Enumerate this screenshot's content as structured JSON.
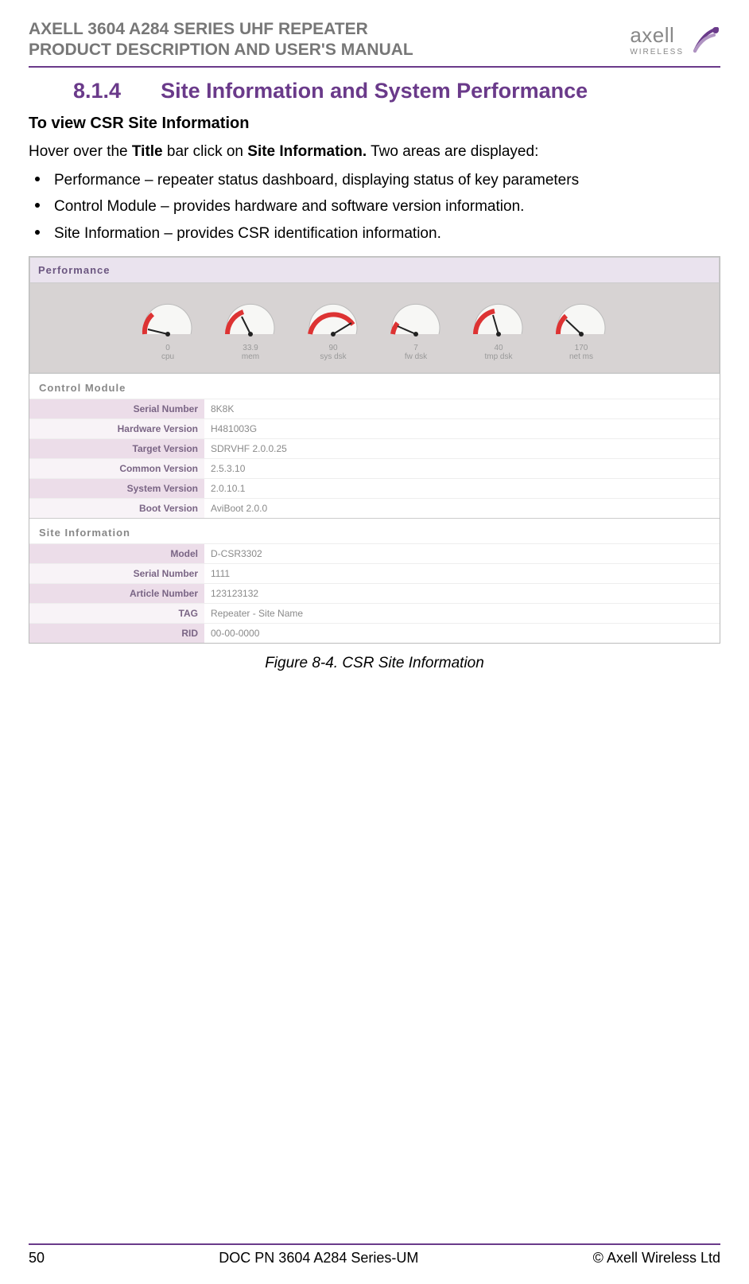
{
  "header": {
    "line1": "AXELL 3604 A284 SERIES UHF REPEATER",
    "line2": "PRODUCT DESCRIPTION AND USER'S MANUAL",
    "brand_name": "axell",
    "brand_sub": "WIRELESS"
  },
  "section": {
    "number": "8.1.4",
    "title": "Site Information and System Performance"
  },
  "subheading": "To view CSR Site Information",
  "intro_pre": "Hover over the ",
  "intro_bold1": "Title",
  "intro_mid": " bar click on ",
  "intro_bold2": "Site Information.",
  "intro_post": " Two areas are displayed:",
  "bullets": [
    "Performance – repeater status dashboard, displaying status of key parameters",
    "Control Module – provides hardware and software version information.",
    "Site Information – provides CSR identification information."
  ],
  "panels": {
    "performance_title": "Performance",
    "gauges": [
      {
        "label": "cpu",
        "value": "0"
      },
      {
        "label": "mem",
        "value": "33.9"
      },
      {
        "label": "sys dsk",
        "value": "90"
      },
      {
        "label": "fw dsk",
        "value": "7"
      },
      {
        "label": "tmp dsk",
        "value": "40"
      },
      {
        "label": "net ms",
        "value": "170"
      }
    ],
    "control_module_title": "Control Module",
    "control_module_rows": [
      {
        "k": "Serial Number",
        "v": "8K8K"
      },
      {
        "k": "Hardware Version",
        "v": "H481003G"
      },
      {
        "k": "Target Version",
        "v": "SDRVHF 2.0.0.25"
      },
      {
        "k": "Common Version",
        "v": "2.5.3.10"
      },
      {
        "k": "System Version",
        "v": "2.0.10.1"
      },
      {
        "k": "Boot Version",
        "v": "AviBoot 2.0.0"
      }
    ],
    "site_info_title": "Site Information",
    "site_info_rows": [
      {
        "k": "Model",
        "v": "D-CSR3302"
      },
      {
        "k": "Serial Number",
        "v": "1111"
      },
      {
        "k": "Article Number",
        "v": "123123132"
      },
      {
        "k": "TAG",
        "v": "Repeater - Site Name"
      },
      {
        "k": "RID",
        "v": "00-00-0000"
      }
    ]
  },
  "figure_caption": "Figure 8-4. CSR Site Information",
  "footer": {
    "page": "50",
    "doc": "DOC PN 3604 A284 Series-UM",
    "copyright": "© Axell Wireless Ltd"
  }
}
